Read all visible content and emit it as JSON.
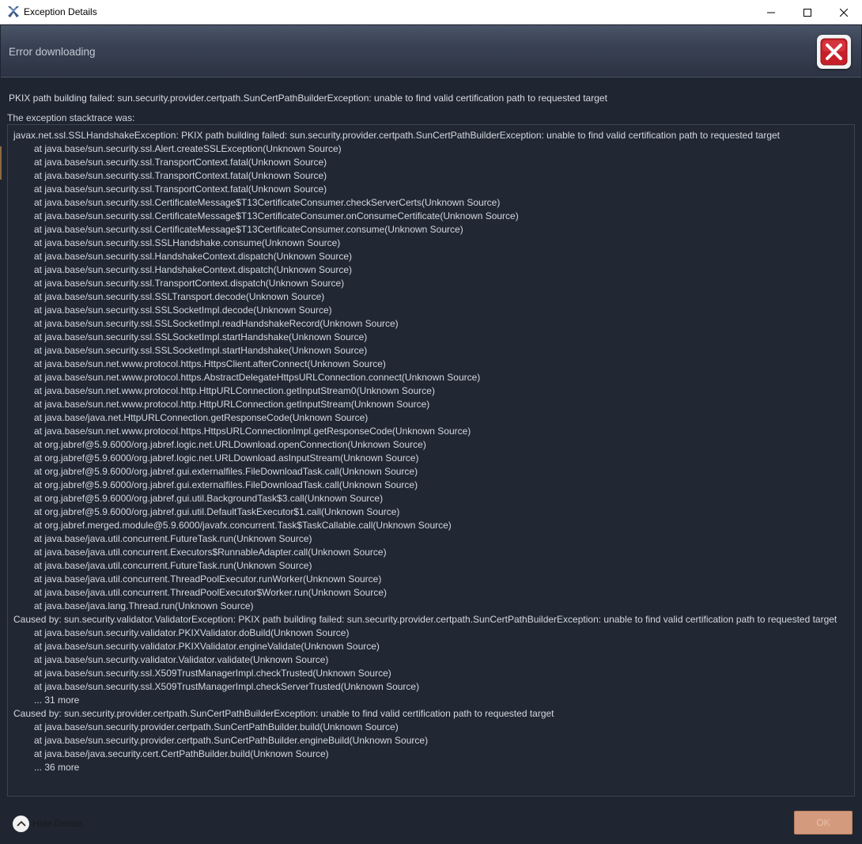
{
  "window": {
    "title": "Exception Details",
    "controls": [
      "minimize-icon",
      "maximize-icon",
      "close-icon"
    ]
  },
  "header": {
    "title": "Error downloading",
    "icon": "error-x-icon",
    "icon_color": "#c8202a"
  },
  "message": "PKIX path building failed: sun.security.provider.certpath.SunCertPathBuilderException: unable to find valid certification path to requested target",
  "stacktrace_label": "The exception stacktrace was:",
  "stacktrace": [
    {
      "text": "javax.net.ssl.SSLHandshakeException: PKIX path building failed: sun.security.provider.certpath.SunCertPathBuilderException: unable to find valid certification path to requested target",
      "indent": false
    },
    {
      "text": "at java.base/sun.security.ssl.Alert.createSSLException(Unknown Source)",
      "indent": true
    },
    {
      "text": "at java.base/sun.security.ssl.TransportContext.fatal(Unknown Source)",
      "indent": true
    },
    {
      "text": "at java.base/sun.security.ssl.TransportContext.fatal(Unknown Source)",
      "indent": true
    },
    {
      "text": "at java.base/sun.security.ssl.TransportContext.fatal(Unknown Source)",
      "indent": true
    },
    {
      "text": "at java.base/sun.security.ssl.CertificateMessage$T13CertificateConsumer.checkServerCerts(Unknown Source)",
      "indent": true
    },
    {
      "text": "at java.base/sun.security.ssl.CertificateMessage$T13CertificateConsumer.onConsumeCertificate(Unknown Source)",
      "indent": true
    },
    {
      "text": "at java.base/sun.security.ssl.CertificateMessage$T13CertificateConsumer.consume(Unknown Source)",
      "indent": true
    },
    {
      "text": "at java.base/sun.security.ssl.SSLHandshake.consume(Unknown Source)",
      "indent": true
    },
    {
      "text": "at java.base/sun.security.ssl.HandshakeContext.dispatch(Unknown Source)",
      "indent": true
    },
    {
      "text": "at java.base/sun.security.ssl.HandshakeContext.dispatch(Unknown Source)",
      "indent": true
    },
    {
      "text": "at java.base/sun.security.ssl.TransportContext.dispatch(Unknown Source)",
      "indent": true
    },
    {
      "text": "at java.base/sun.security.ssl.SSLTransport.decode(Unknown Source)",
      "indent": true
    },
    {
      "text": "at java.base/sun.security.ssl.SSLSocketImpl.decode(Unknown Source)",
      "indent": true
    },
    {
      "text": "at java.base/sun.security.ssl.SSLSocketImpl.readHandshakeRecord(Unknown Source)",
      "indent": true
    },
    {
      "text": "at java.base/sun.security.ssl.SSLSocketImpl.startHandshake(Unknown Source)",
      "indent": true
    },
    {
      "text": "at java.base/sun.security.ssl.SSLSocketImpl.startHandshake(Unknown Source)",
      "indent": true
    },
    {
      "text": "at java.base/sun.net.www.protocol.https.HttpsClient.afterConnect(Unknown Source)",
      "indent": true
    },
    {
      "text": "at java.base/sun.net.www.protocol.https.AbstractDelegateHttpsURLConnection.connect(Unknown Source)",
      "indent": true
    },
    {
      "text": "at java.base/sun.net.www.protocol.http.HttpURLConnection.getInputStream0(Unknown Source)",
      "indent": true
    },
    {
      "text": "at java.base/sun.net.www.protocol.http.HttpURLConnection.getInputStream(Unknown Source)",
      "indent": true
    },
    {
      "text": "at java.base/java.net.HttpURLConnection.getResponseCode(Unknown Source)",
      "indent": true
    },
    {
      "text": "at java.base/sun.net.www.protocol.https.HttpsURLConnectionImpl.getResponseCode(Unknown Source)",
      "indent": true
    },
    {
      "text": "at org.jabref@5.9.6000/org.jabref.logic.net.URLDownload.openConnection(Unknown Source)",
      "indent": true
    },
    {
      "text": "at org.jabref@5.9.6000/org.jabref.logic.net.URLDownload.asInputStream(Unknown Source)",
      "indent": true
    },
    {
      "text": "at org.jabref@5.9.6000/org.jabref.gui.externalfiles.FileDownloadTask.call(Unknown Source)",
      "indent": true
    },
    {
      "text": "at org.jabref@5.9.6000/org.jabref.gui.externalfiles.FileDownloadTask.call(Unknown Source)",
      "indent": true
    },
    {
      "text": "at org.jabref@5.9.6000/org.jabref.gui.util.BackgroundTask$3.call(Unknown Source)",
      "indent": true
    },
    {
      "text": "at org.jabref@5.9.6000/org.jabref.gui.util.DefaultTaskExecutor$1.call(Unknown Source)",
      "indent": true
    },
    {
      "text": "at org.jabref.merged.module@5.9.6000/javafx.concurrent.Task$TaskCallable.call(Unknown Source)",
      "indent": true
    },
    {
      "text": "at java.base/java.util.concurrent.FutureTask.run(Unknown Source)",
      "indent": true
    },
    {
      "text": "at java.base/java.util.concurrent.Executors$RunnableAdapter.call(Unknown Source)",
      "indent": true
    },
    {
      "text": "at java.base/java.util.concurrent.FutureTask.run(Unknown Source)",
      "indent": true
    },
    {
      "text": "at java.base/java.util.concurrent.ThreadPoolExecutor.runWorker(Unknown Source)",
      "indent": true
    },
    {
      "text": "at java.base/java.util.concurrent.ThreadPoolExecutor$Worker.run(Unknown Source)",
      "indent": true
    },
    {
      "text": "at java.base/java.lang.Thread.run(Unknown Source)",
      "indent": true
    },
    {
      "text": "Caused by: sun.security.validator.ValidatorException: PKIX path building failed: sun.security.provider.certpath.SunCertPathBuilderException: unable to find valid certification path to requested target",
      "indent": false
    },
    {
      "text": "at java.base/sun.security.validator.PKIXValidator.doBuild(Unknown Source)",
      "indent": true
    },
    {
      "text": "at java.base/sun.security.validator.PKIXValidator.engineValidate(Unknown Source)",
      "indent": true
    },
    {
      "text": "at java.base/sun.security.validator.Validator.validate(Unknown Source)",
      "indent": true
    },
    {
      "text": "at java.base/sun.security.ssl.X509TrustManagerImpl.checkTrusted(Unknown Source)",
      "indent": true
    },
    {
      "text": "at java.base/sun.security.ssl.X509TrustManagerImpl.checkServerTrusted(Unknown Source)",
      "indent": true
    },
    {
      "text": "... 31 more",
      "indent": true
    },
    {
      "text": "Caused by: sun.security.provider.certpath.SunCertPathBuilderException: unable to find valid certification path to requested target",
      "indent": false
    },
    {
      "text": "at java.base/sun.security.provider.certpath.SunCertPathBuilder.build(Unknown Source)",
      "indent": true
    },
    {
      "text": "at java.base/sun.security.provider.certpath.SunCertPathBuilder.engineBuild(Unknown Source)",
      "indent": true
    },
    {
      "text": "at java.base/java.security.cert.CertPathBuilder.build(Unknown Source)",
      "indent": true
    },
    {
      "text": "... 36 more",
      "indent": true
    }
  ],
  "footer": {
    "hide_details_label": "Hide Details",
    "hide_details_icon": "chevron-up-icon",
    "ok_label": "OK"
  },
  "colors": {
    "accent": "#d49a7e",
    "background": "#1f2632"
  }
}
